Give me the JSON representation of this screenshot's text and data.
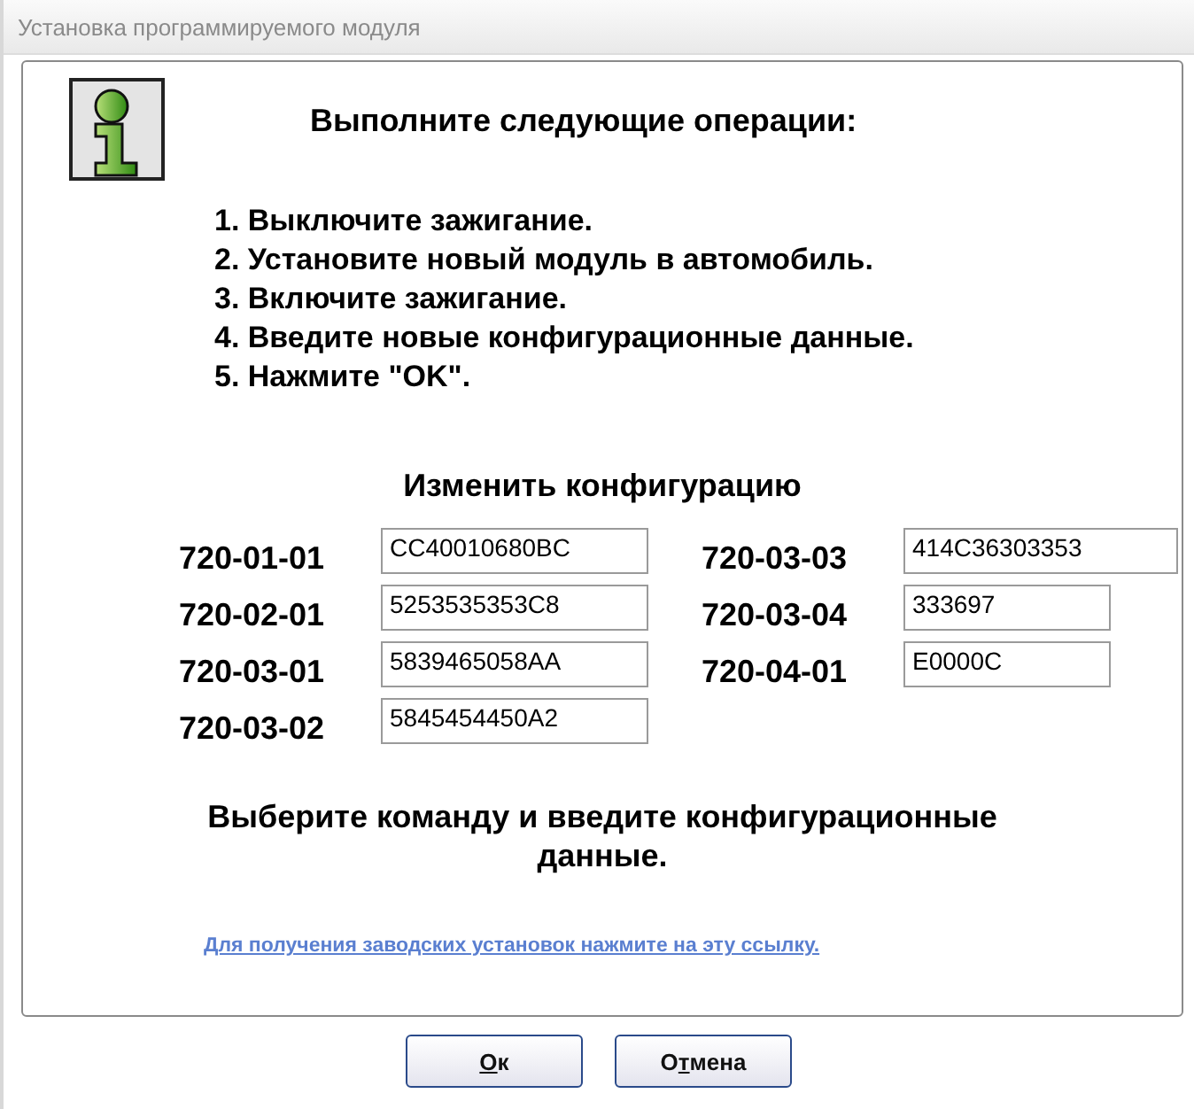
{
  "window": {
    "title": "Установка программируемого модуля"
  },
  "heading": "Выполните следующие операции:",
  "steps": [
    "1. Выключите зажигание.",
    "2. Установите новый модуль в автомобиль.",
    "3. Включите зажигание.",
    "4. Введите новые конфигурационные данные.",
    "5. Нажмите \"OK\"."
  ],
  "config": {
    "title": "Изменить конфигурацию",
    "left": [
      {
        "label": "720-01-01",
        "value": "CC40010680BC"
      },
      {
        "label": "720-02-01",
        "value": "5253535353C8"
      },
      {
        "label": "720-03-01",
        "value": "5839465058AA"
      },
      {
        "label": "720-03-02",
        "value": "5845454450A2"
      }
    ],
    "right": [
      {
        "label": "720-03-03",
        "value": "414C36303353",
        "kind": "wide"
      },
      {
        "label": "720-03-04",
        "value": "333697",
        "kind": "narrow"
      },
      {
        "label": "720-04-01",
        "value": "E0000C",
        "kind": "narrow"
      }
    ]
  },
  "instruction": "Выберите команду и введите конфигурационные данные.",
  "link": "Для получения заводских установок нажмите на эту ссылку.",
  "buttons": [
    {
      "key": "О",
      "after": "к"
    },
    {
      "before": "О",
      "key": "т",
      "after": "мена"
    }
  ]
}
